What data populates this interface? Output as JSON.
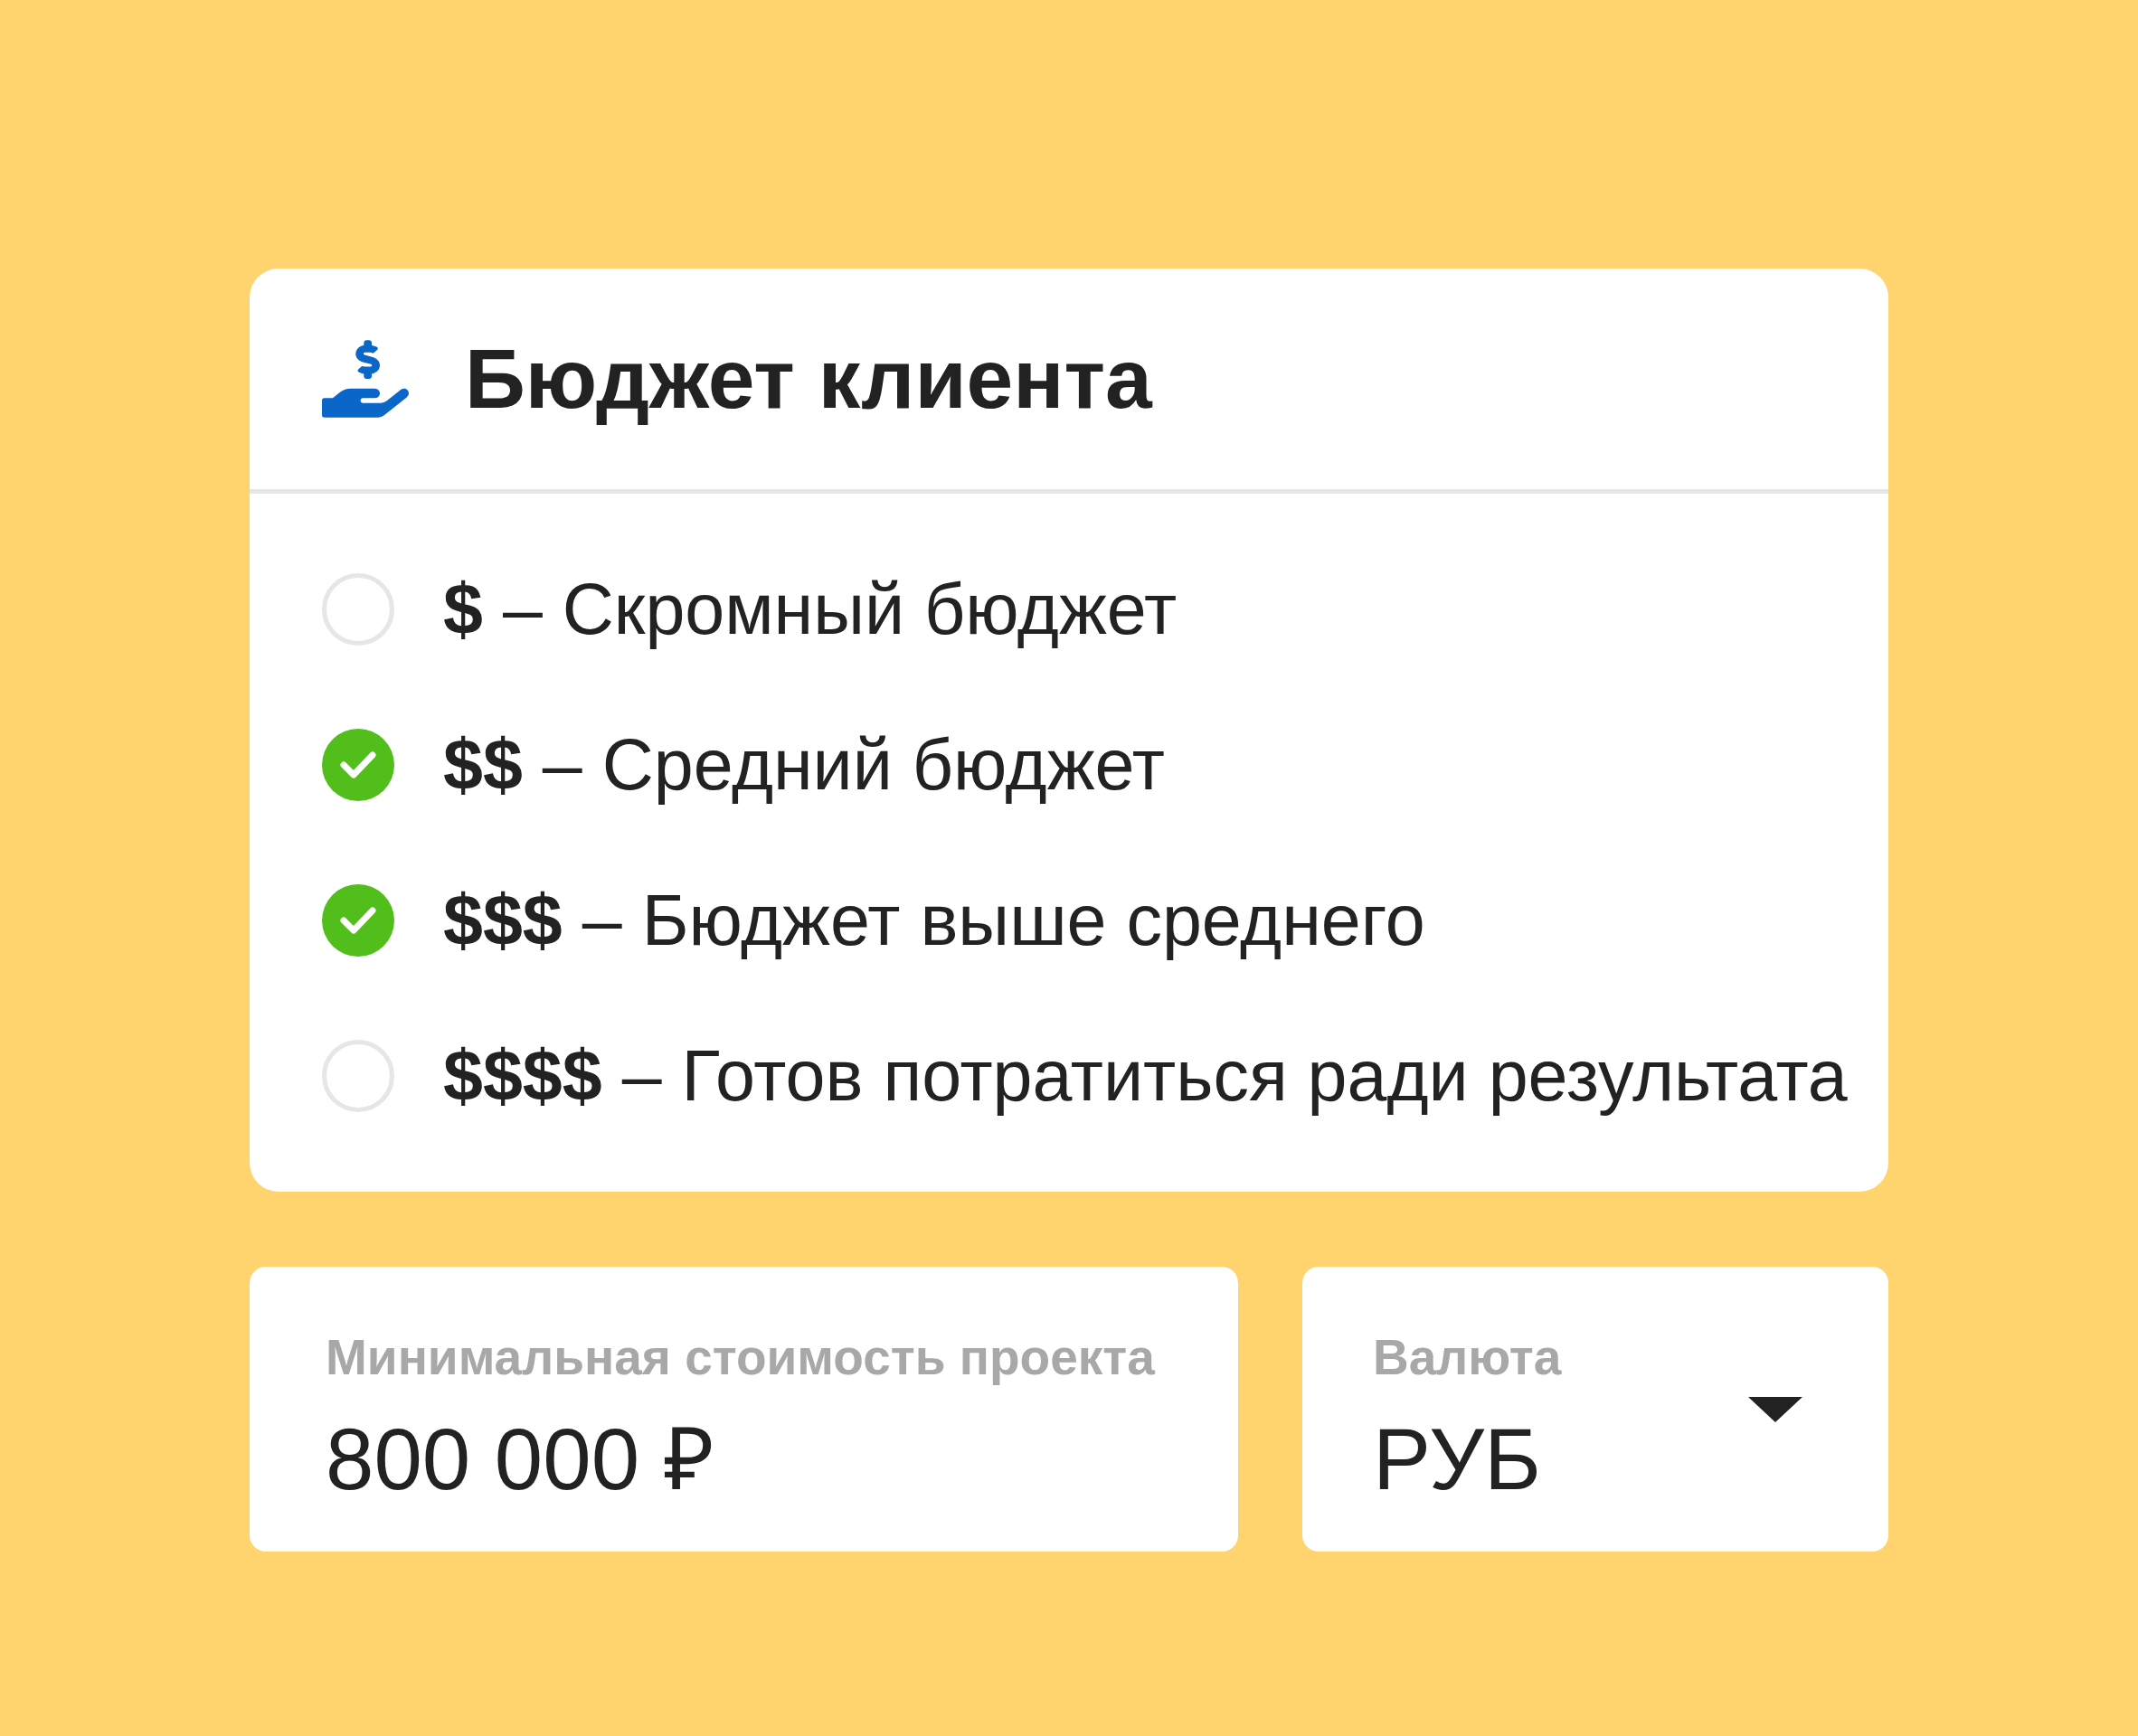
{
  "header": {
    "title": "Бюджет клиента"
  },
  "options": [
    {
      "label": "**$** – Скромный бюджет",
      "checked": false
    },
    {
      "label": "**$$** – Средний бюджет",
      "checked": true
    },
    {
      "label": "**$$$** – Бюджет выше среднего",
      "checked": true
    },
    {
      "label": "**$$$$** – Готов потратиться ради результата",
      "checked": false
    }
  ],
  "fields": [
    {
      "kind": "text",
      "label": "Минимальная стоимость проекта",
      "value": "800 000 ₽"
    },
    {
      "kind": "select",
      "label": "Валюта",
      "value": "РУБ"
    }
  ]
}
